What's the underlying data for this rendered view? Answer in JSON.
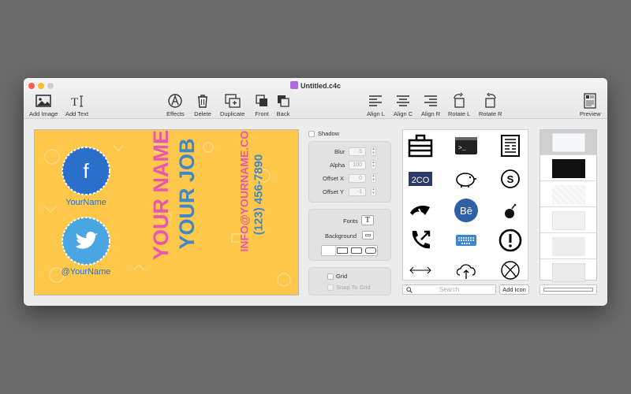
{
  "window": {
    "title": "Untitled.c4c"
  },
  "toolbar": {
    "add_image": "Add Image",
    "add_text": "Add Text",
    "effects": "Effects",
    "delete": "Delete",
    "duplicate": "Duplicate",
    "front": "Front",
    "back": "Back",
    "align_l": "Align L",
    "align_c": "Align C",
    "align_r": "Align R",
    "rotate_l": "Rotate L",
    "rotate_r": "Rotate R",
    "preview": "Preview"
  },
  "card": {
    "facebook_label": "YourName",
    "twitter_label": "@YourName",
    "name": "YOUR NAME",
    "job": "YOUR JOB",
    "email": "INFO@YOURNAME.COM",
    "phone": "(123) 456-7890",
    "background_color": "#ffc84a"
  },
  "effects_panel": {
    "shadow_label": "Shadow",
    "blur_label": "Blur",
    "blur_value": "5",
    "alpha_label": "Alpha",
    "alpha_value": "100",
    "offset_x_label": "Offset X",
    "offset_x_value": "0",
    "offset_y_label": "Offset Y",
    "offset_y_value": "-1"
  },
  "style_panel": {
    "fonts_label": "Fonts",
    "fonts_button": "T",
    "background_label": "Background"
  },
  "grid_panel": {
    "grid_label": "Grid",
    "snap_label": "Snap To Grid"
  },
  "icons_panel": {
    "search_placeholder": "Search",
    "add_icon_label": "Add Icon",
    "icons": [
      "briefcase-icon",
      "terminal-icon",
      "newspaper-icon",
      "2co-icon",
      "piggy-bank-icon",
      "skype-icon",
      "deviantart-icon",
      "behance-icon",
      "bomb-icon",
      "phone-outgoing-icon",
      "keyboard-icon",
      "alert-icon",
      "arrows-horizontal-icon",
      "cloud-upload-icon",
      "xbox-icon"
    ],
    "icon_texts": {
      "2co": "2CO",
      "behance": "Bē",
      "terminal": ">_"
    }
  },
  "thumbnails": {
    "count": 6
  }
}
